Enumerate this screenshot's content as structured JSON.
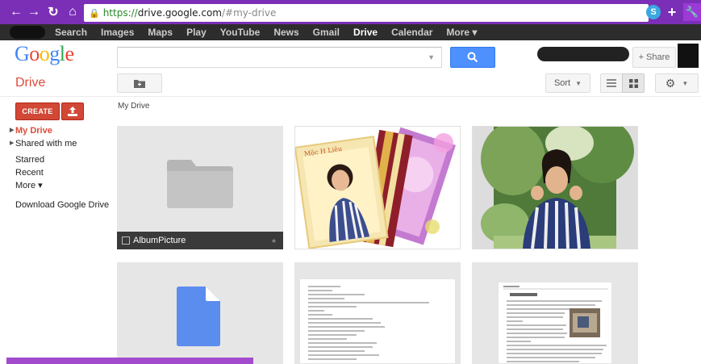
{
  "browser": {
    "url_https": "https://",
    "url_host": "drive.google.com",
    "url_path": "/#my-drive",
    "skype_label": "S"
  },
  "gbar": {
    "items": [
      "Search",
      "Images",
      "Maps",
      "Play",
      "YouTube",
      "News",
      "Gmail",
      "Drive",
      "Calendar",
      "More ▾"
    ],
    "active": "Drive"
  },
  "header": {
    "logo": "Google",
    "share_label": "+ Share"
  },
  "toolbar": {
    "drive_title": "Drive",
    "sort_label": "Sort"
  },
  "sidebar": {
    "create_label": "CREATE",
    "items": [
      {
        "label": "My Drive",
        "active": true,
        "expandable": true
      },
      {
        "label": "Shared with me",
        "active": false,
        "expandable": true
      },
      {
        "label": "Starred",
        "active": false,
        "expandable": false
      },
      {
        "label": "Recent",
        "active": false,
        "expandable": false
      },
      {
        "label": "More ▾",
        "active": false,
        "expandable": false
      }
    ],
    "download": "Download Google Drive"
  },
  "breadcrumb": "My Drive",
  "files": {
    "folder_name": "AlbumPicture"
  },
  "colors": {
    "browser_bar": "#7b2fb6",
    "drive_red": "#dd4b39",
    "search_blue": "#4d90fe"
  }
}
